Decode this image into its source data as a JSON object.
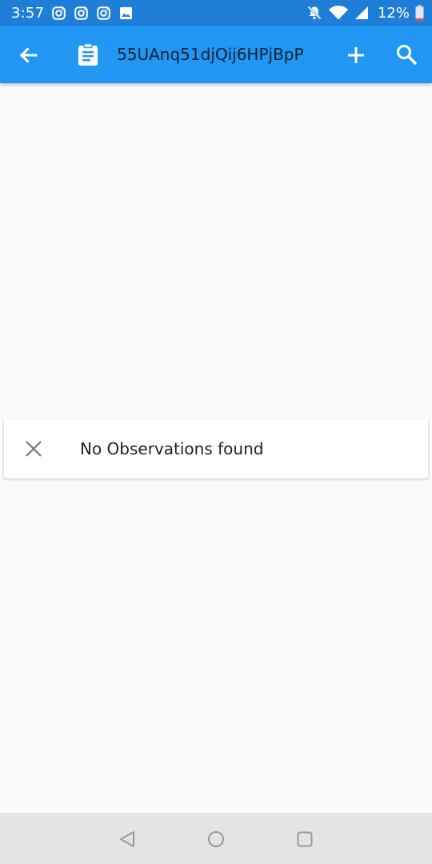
{
  "status_bar": {
    "time": "3:57",
    "notification_icons": [
      "instagram-icon",
      "instagram-icon",
      "instagram-icon",
      "image-icon"
    ],
    "system_icons": [
      "bell-off-icon",
      "wifi-icon",
      "signal-icon"
    ],
    "battery_percent": "12%",
    "battery_level": 0.12
  },
  "app_bar": {
    "title": "55UAnq51djQij6HPjBpP",
    "color": "#2196f3",
    "back_icon": "arrow-left-icon",
    "leading_icon": "clipboard-icon",
    "actions": [
      "add-icon",
      "search-icon"
    ]
  },
  "empty_state": {
    "icon": "close-icon",
    "message": "No Observations found"
  },
  "nav_bar": {
    "buttons": [
      "back-triangle-icon",
      "home-circle-icon",
      "recents-square-icon"
    ]
  }
}
